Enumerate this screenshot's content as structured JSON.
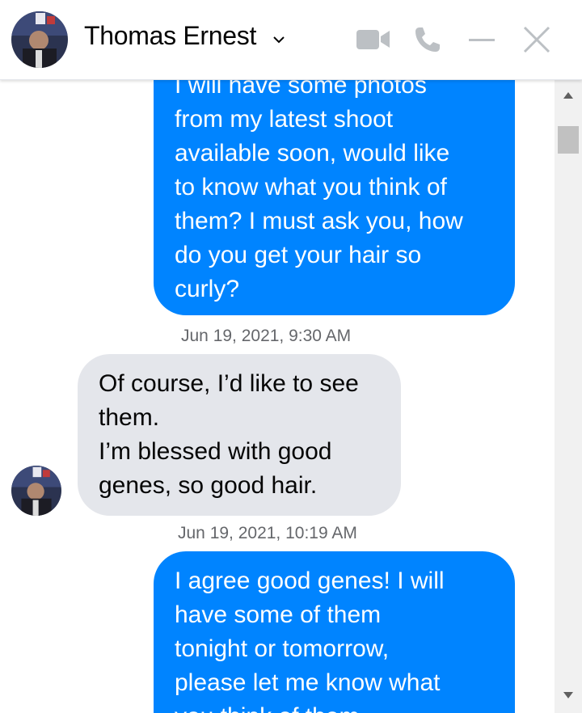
{
  "header": {
    "contact_name": "Thomas Ernest",
    "icons": [
      "avatar-photo",
      "chevron-down-icon",
      "video-camera-icon",
      "phone-icon",
      "minimize-icon",
      "close-icon"
    ]
  },
  "conversation": {
    "messages": [
      {
        "direction": "outgoing",
        "text": "I will have some photos\nfrom my latest shoot\navailable soon, would like\nto know what you think of\nthem? I must ask you, how\ndo you get your hair so\ncurly?"
      },
      {
        "timestamp": "Jun 19, 2021, 9:30 AM"
      },
      {
        "direction": "incoming",
        "text": "Of course, I’d like to see\nthem.\nI’m blessed with good\ngenes, so good hair."
      },
      {
        "timestamp": "Jun 19, 2021, 10:19 AM"
      },
      {
        "direction": "outgoing",
        "text": "I agree good genes! I will\nhave some of them\ntonight or tomorrow,\nplease let me know what\nyou think of them"
      }
    ]
  },
  "colors": {
    "outgoing_bubble": "#0084ff",
    "incoming_bubble": "#e4e6eb",
    "header_icons": "#bcc0c4",
    "timestamp_text": "#65676b"
  }
}
